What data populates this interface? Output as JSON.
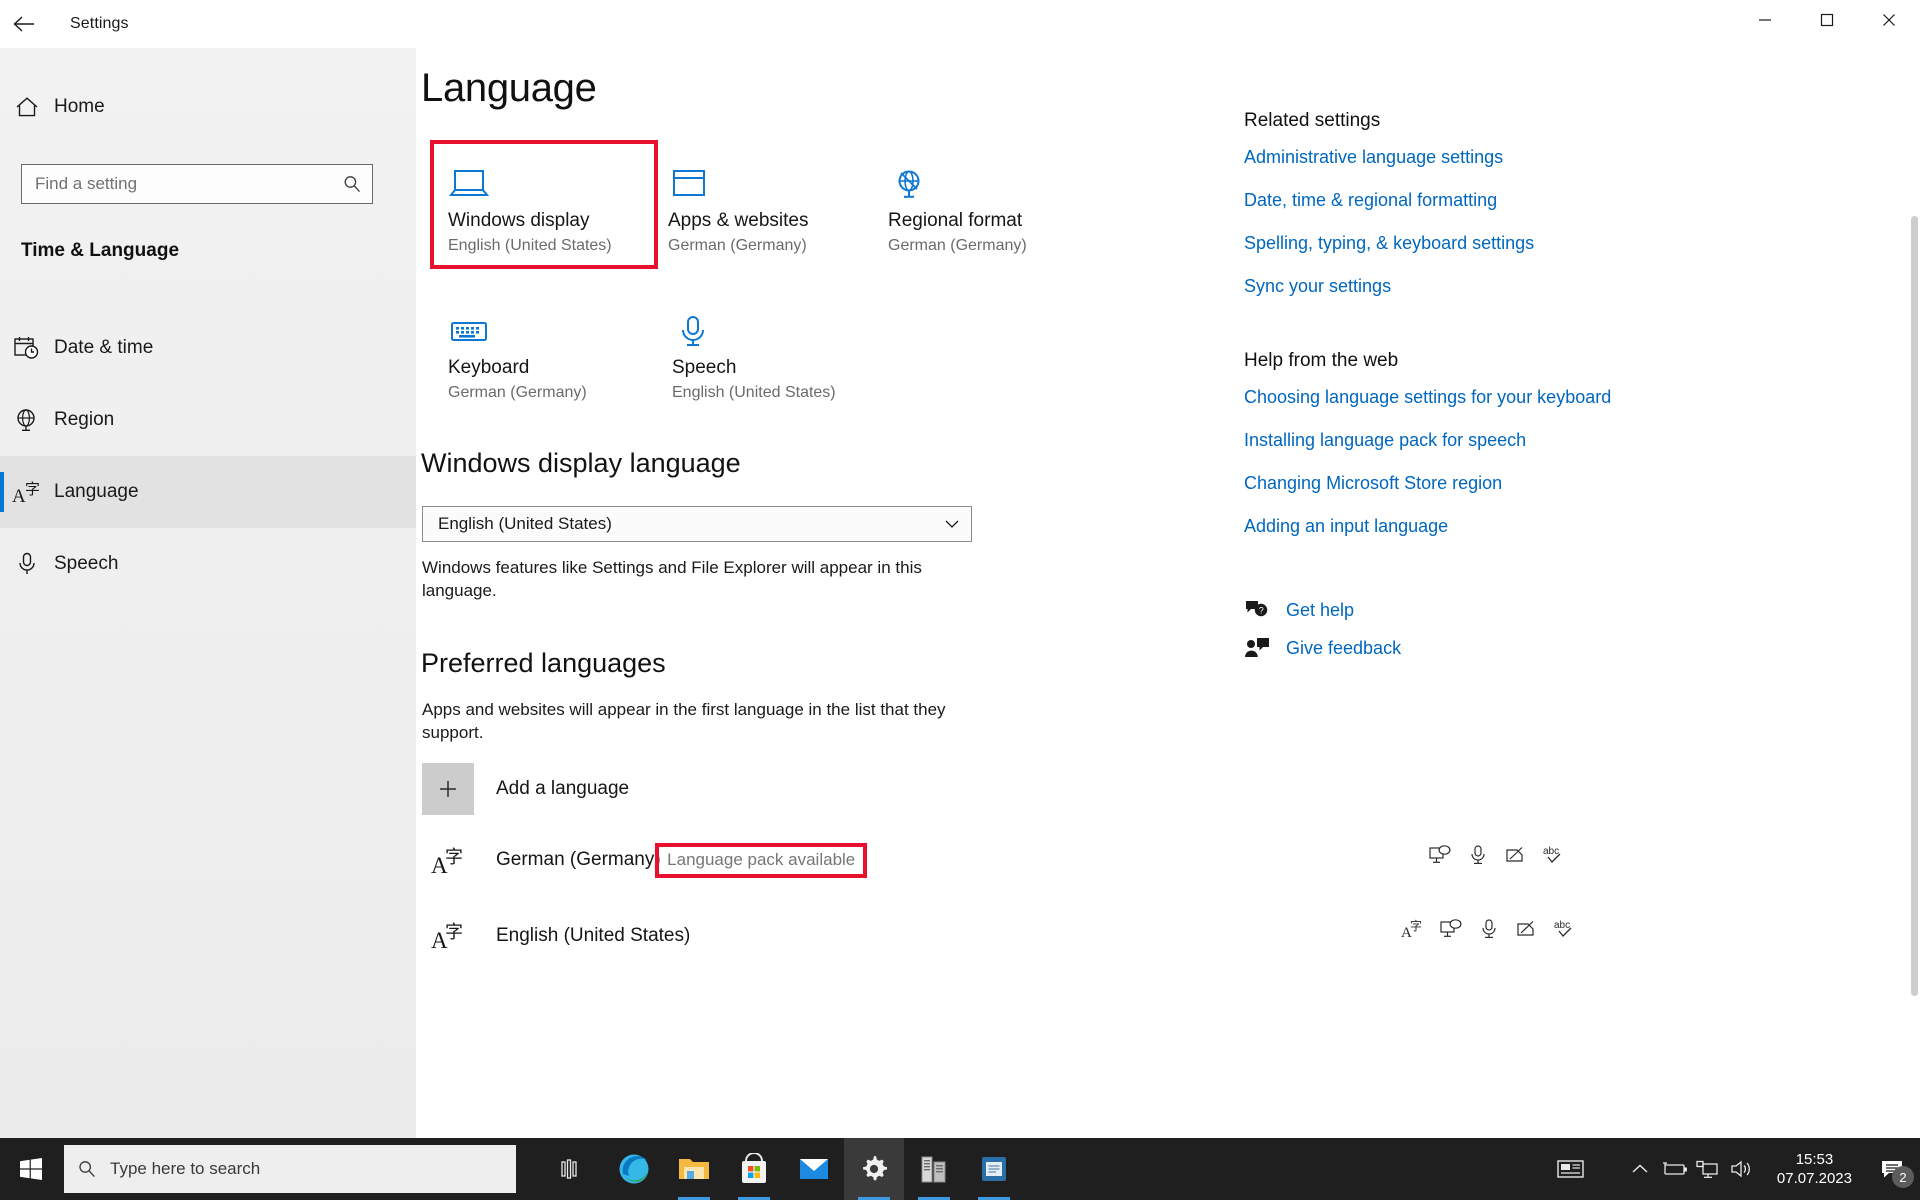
{
  "window": {
    "app_title": "Settings",
    "back_icon": "back-arrow-icon",
    "minimize_label": "–",
    "maximize_label": "□",
    "close_label": "✕"
  },
  "sidebar": {
    "home_label": "Home",
    "home_icon": "home-icon",
    "search": {
      "placeholder": "Find a setting",
      "value": "",
      "icon": "search-icon"
    },
    "category": "Time & Language",
    "items": [
      {
        "label": "Date & time",
        "icon": "calendar-clock-icon",
        "selected": false
      },
      {
        "label": "Region",
        "icon": "globe-stand-icon",
        "selected": false
      },
      {
        "label": "Language",
        "icon": "language-icon",
        "selected": true
      },
      {
        "label": "Speech",
        "icon": "microphone-icon",
        "selected": false
      }
    ]
  },
  "main": {
    "page_title": "Language",
    "tiles": [
      {
        "name": "Windows display",
        "value": "English (United States)",
        "icon": "laptop-icon",
        "highlighted": true
      },
      {
        "name": "Apps & websites",
        "value": "German (Germany)",
        "icon": "window-icon",
        "highlighted": false
      },
      {
        "name": "Regional format",
        "value": "German (Germany)",
        "icon": "globe-stand-icon",
        "highlighted": false
      },
      {
        "name": "Keyboard",
        "value": "German (Germany)",
        "icon": "keyboard-icon",
        "highlighted": false
      },
      {
        "name": "Speech",
        "value": "English (United States)",
        "icon": "microphone-icon",
        "highlighted": false
      }
    ],
    "display_language": {
      "heading": "Windows display language",
      "selected": "English (United States)",
      "chevron_icon": "chevron-down-icon",
      "description": "Windows features like Settings and File Explorer will appear in this language."
    },
    "preferred_languages": {
      "heading": "Preferred languages",
      "description": "Apps and websites will appear in the first language in the list that they support.",
      "add_label": "Add a language",
      "add_icon": "plus-icon",
      "rows": [
        {
          "name": "German (Germany)",
          "status": "Language pack available",
          "status_highlighted": true,
          "icon": "language-icon",
          "actions": [
            "display-language-icon",
            "speech-icon",
            "handwriting-icon",
            "spellcheck-icon"
          ]
        },
        {
          "name": "English (United States)",
          "status": "",
          "status_highlighted": false,
          "icon": "language-icon",
          "actions": [
            "language-icon",
            "display-language-icon",
            "speech-icon",
            "handwriting-icon",
            "spellcheck-icon"
          ]
        }
      ]
    }
  },
  "rail": {
    "related_heading": "Related settings",
    "related_links": [
      "Administrative language settings",
      "Date, time & regional formatting",
      "Spelling, typing, & keyboard settings",
      "Sync your settings"
    ],
    "help_heading": "Help from the web",
    "help_links": [
      "Choosing language settings for your keyboard",
      "Installing language pack for speech",
      "Changing Microsoft Store region",
      "Adding an input language"
    ],
    "support": [
      {
        "label": "Get help",
        "icon": "help-bubble-icon"
      },
      {
        "label": "Give feedback",
        "icon": "feedback-person-icon"
      }
    ]
  },
  "taskbar": {
    "start_icon": "windows-start-icon",
    "search_placeholder": "Type here to search",
    "search_icon": "search-icon",
    "apps": [
      {
        "name": "task-view-icon",
        "active": false,
        "running": false
      },
      {
        "name": "edge-icon",
        "active": false,
        "running": false
      },
      {
        "name": "file-explorer-icon",
        "active": false,
        "running": true
      },
      {
        "name": "microsoft-store-icon",
        "active": false,
        "running": true
      },
      {
        "name": "mail-icon",
        "active": false,
        "running": false
      },
      {
        "name": "settings-icon",
        "active": true,
        "running": true
      },
      {
        "name": "server-manager-icon",
        "active": false,
        "running": true
      },
      {
        "name": "notepad-icon",
        "active": false,
        "running": true
      }
    ],
    "tray": {
      "news_icon": "news-weather-icon",
      "chevron_icon": "chevron-up-icon",
      "battery_icon": "battery-charging-icon",
      "network_icon": "network-icon",
      "volume_icon": "volume-icon",
      "time": "15:53",
      "date": "07.07.2023",
      "notification_icon": "action-center-icon",
      "notification_count": "2"
    }
  },
  "colors": {
    "accent": "#0078d7",
    "link": "#0067c0",
    "highlight_red": "#e8112d",
    "progress_green": "#1faa1f",
    "tile_icon_blue": "#0c78d4"
  }
}
